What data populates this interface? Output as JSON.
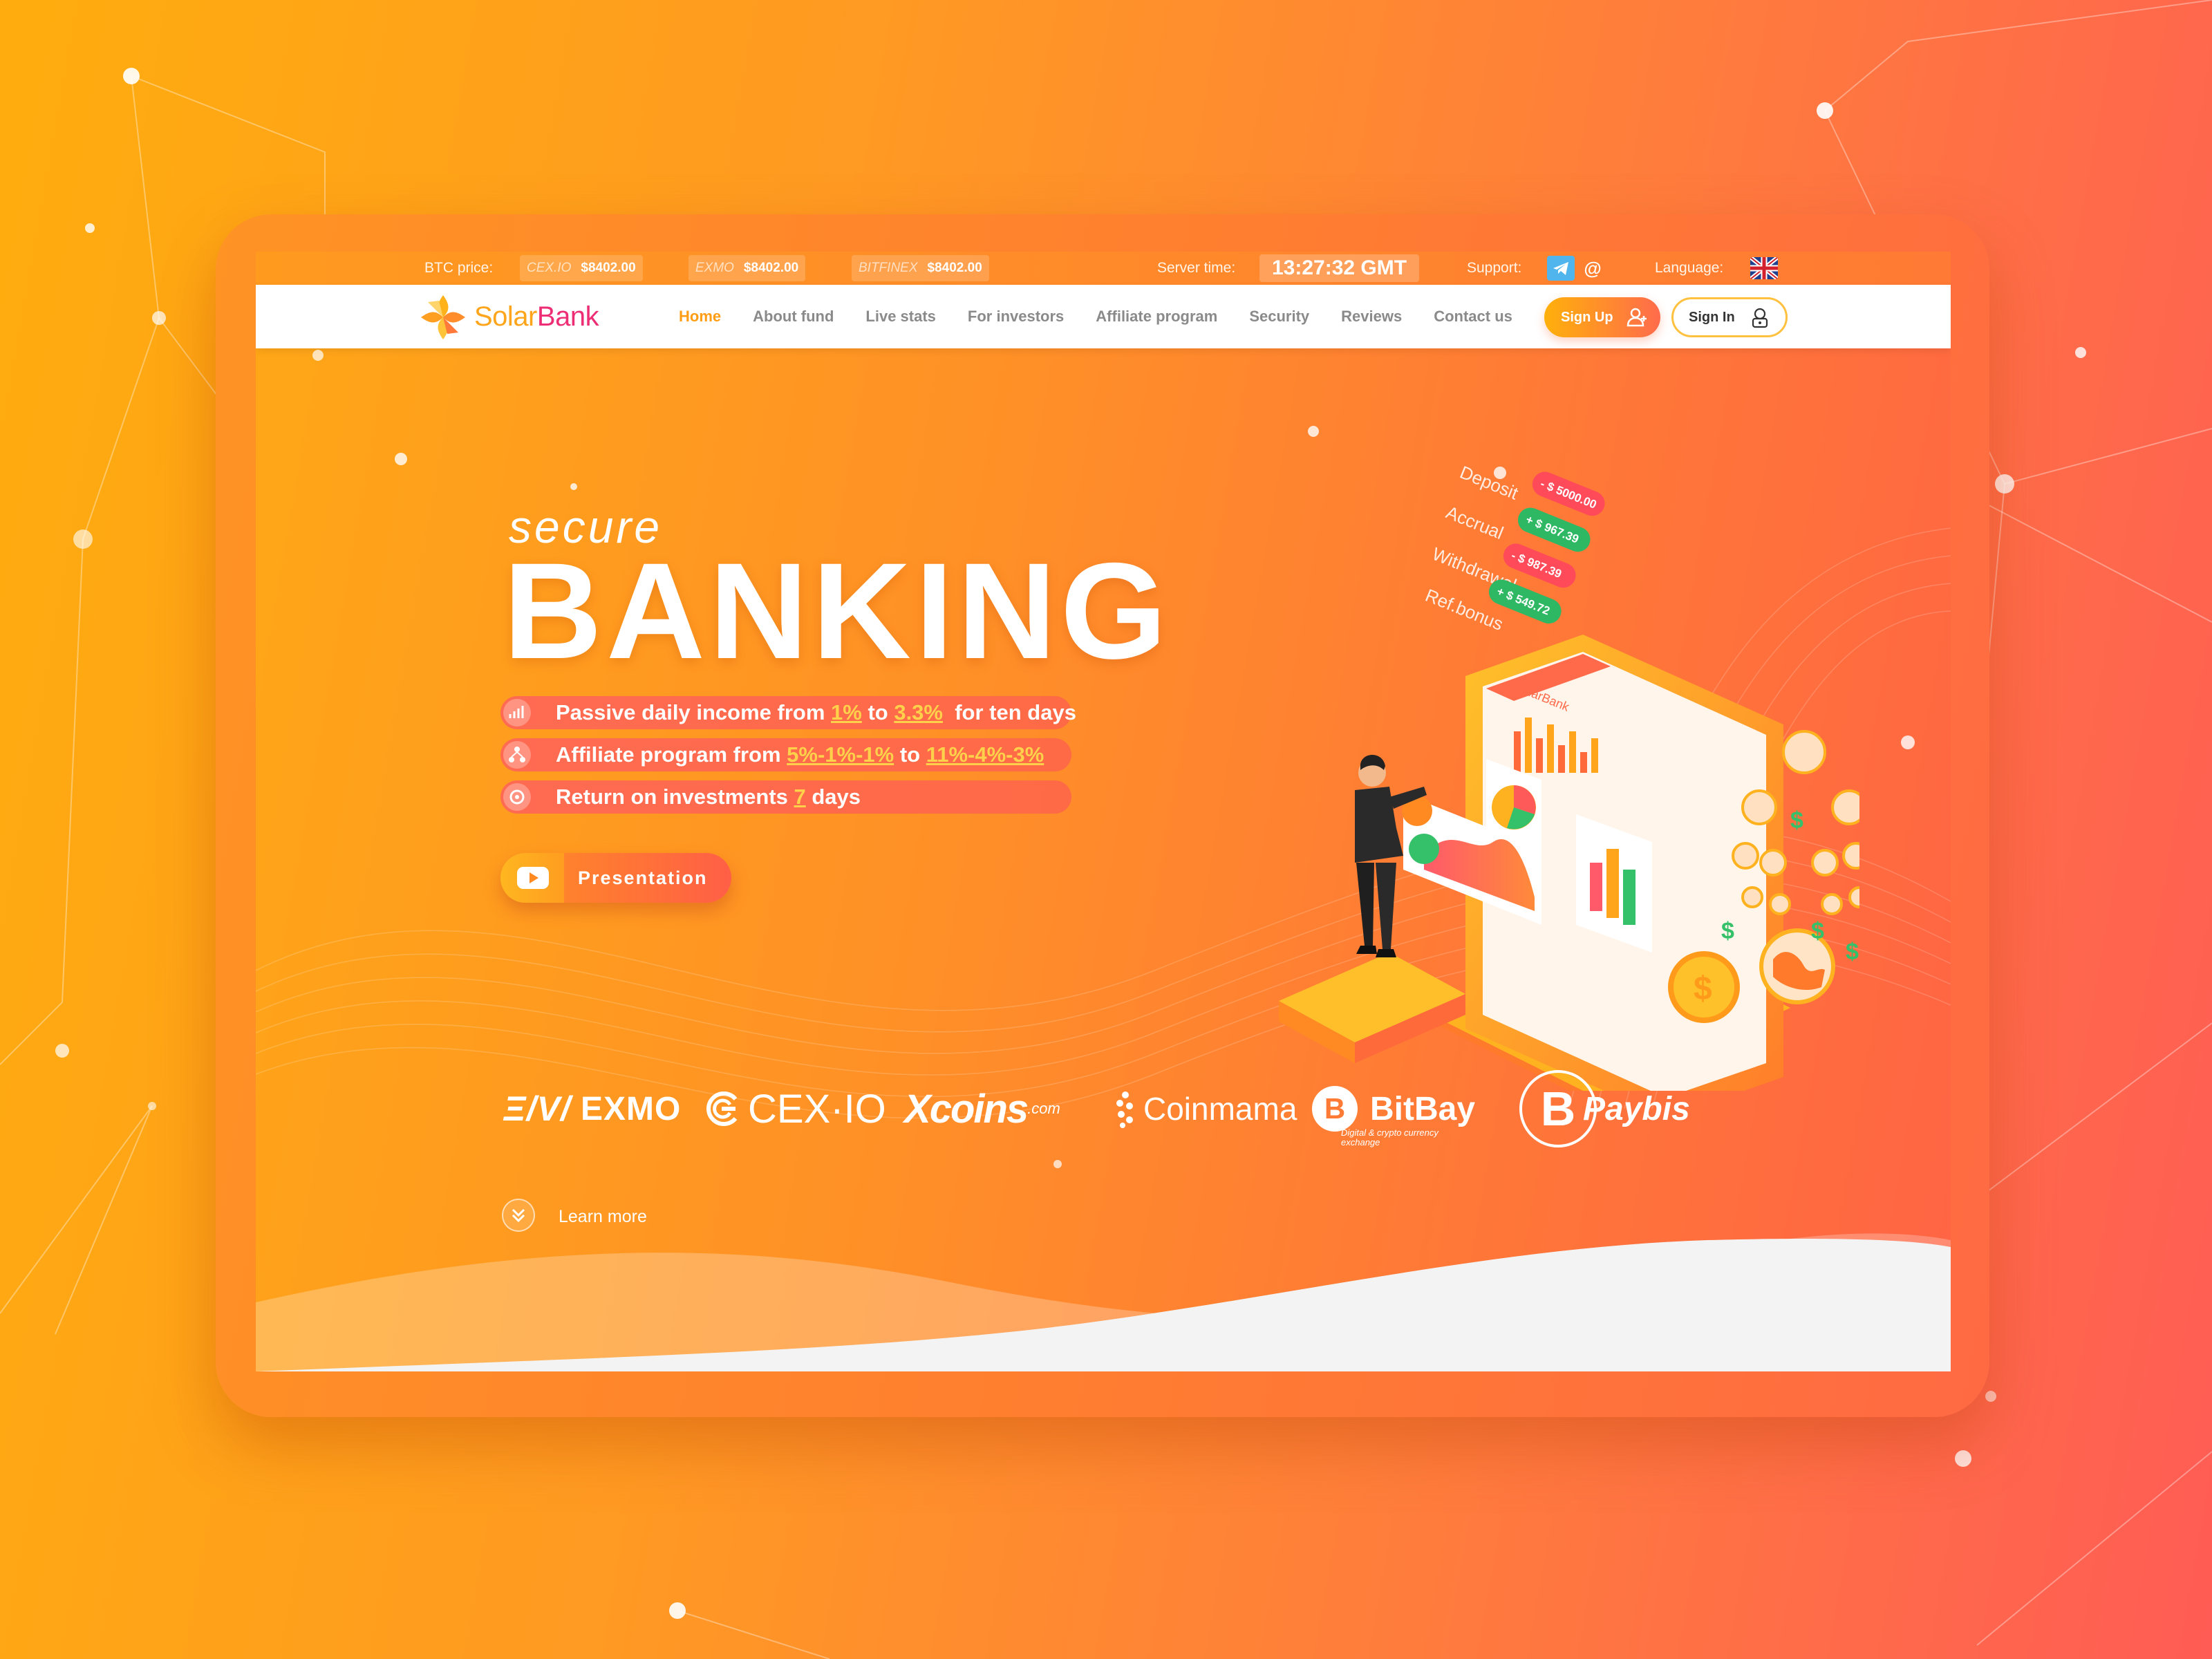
{
  "topbar": {
    "btc_label": "BTC price:",
    "exchanges": [
      {
        "name": "CEX.IO",
        "price": "$8402.00"
      },
      {
        "name": "EXMO",
        "price": "$8402.00"
      },
      {
        "name": "BITFINEX",
        "price": "$8402.00"
      }
    ],
    "server_label": "Server time:",
    "server_time": "13:27:32 GMT",
    "support_label": "Support:",
    "support_icons": [
      "telegram-icon",
      "email-icon"
    ],
    "language_label": "Language:",
    "language_icon": "uk-flag-icon"
  },
  "nav": {
    "logo_part1": "Solar",
    "logo_part2": "Bank",
    "links": [
      "Home",
      "About fund",
      "Live stats",
      "For investors",
      "Affiliate program",
      "Security",
      "Reviews",
      "Contact us"
    ],
    "active_index": 0,
    "signup_label": "Sign Up",
    "signin_label": "Sign In"
  },
  "hero": {
    "kicker": "secure",
    "title": "BANKING",
    "features": [
      {
        "icon": "chart-growth-icon",
        "parts": [
          "Passive daily income from ",
          "1%",
          " to ",
          "3.3%",
          "  for ten days"
        ]
      },
      {
        "icon": "referral-tree-icon",
        "parts": [
          "Affiliate program from ",
          "5%-1%-1%",
          " to ",
          "11%-4%-3%",
          ""
        ]
      },
      {
        "icon": "coin-return-icon",
        "parts": [
          "Return on investments ",
          "7",
          " days",
          "",
          ""
        ]
      }
    ],
    "presentation_label": "Presentation"
  },
  "illustration": {
    "labels": [
      "Deposit",
      "Accrual",
      "Withdrawal",
      "Ref.bonus"
    ],
    "amounts": [
      "- $ 5000.00",
      "+ $ 967.39",
      "- $ 987.39",
      "+ $ 549.72"
    ],
    "phone_brand": "SolarBank"
  },
  "partners": {
    "exmo": "EXMO",
    "exmo_mark": "Ξ/V/",
    "cex": "CEX·IO",
    "xcoins": "coins",
    "xcoins_mark": "X",
    "xcoins_suffix": ".com",
    "coinmama": "Coinmama",
    "bitbay": "BitBay",
    "paybis": "Paybis",
    "paybis_sub": "Digital & crypto currency exchange"
  },
  "learn_more": "Learn more",
  "colors": {
    "accent": "#ff9d15",
    "brand_pink": "#ee2e74",
    "hero_bg_start": "#ffa717",
    "hero_bg_end": "#ff6444",
    "highlight": "#ffd04a"
  }
}
